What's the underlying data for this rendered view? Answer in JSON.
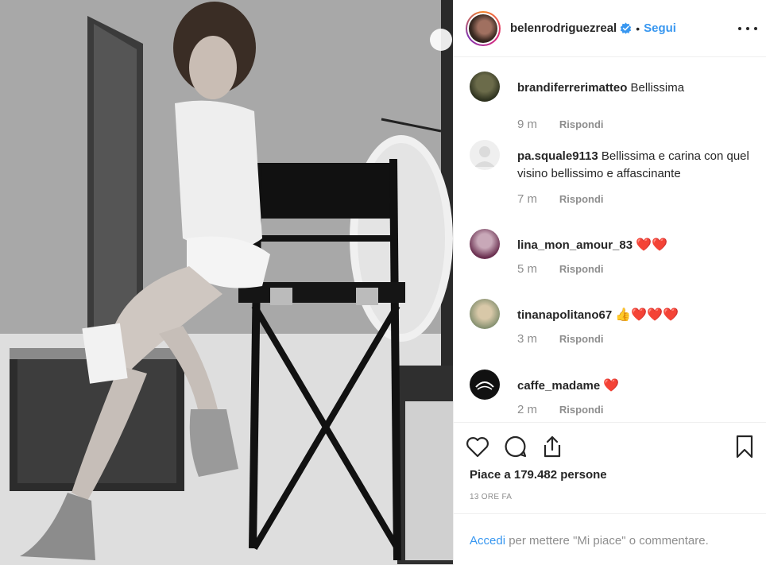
{
  "header": {
    "username": "belenrodriguezreal",
    "separator": "•",
    "follow_label": "Segui",
    "verified_icon": "verified-badge-icon",
    "more_icon": "more-options-icon"
  },
  "comments": [
    {
      "username": "brandiferrerimatteo",
      "text": "Bellissima",
      "emoji": "",
      "ago": "9 m",
      "reply": "Rispondi"
    },
    {
      "username": "pa.squale9113",
      "text": "Bellissima e carina con quel visino bellissimo e affascinante",
      "emoji": "",
      "ago": "7 m",
      "reply": "Rispondi"
    },
    {
      "username": "lina_mon_amour_83",
      "text": "",
      "emoji": "❤️❤️",
      "ago": "5 m",
      "reply": "Rispondi"
    },
    {
      "username": "tinanapolitano67",
      "text": "",
      "emoji": "👍❤️❤️❤️",
      "ago": "3 m",
      "reply": "Rispondi"
    },
    {
      "username": "caffe_madame",
      "text": "",
      "emoji": "❤️",
      "ago": "2 m",
      "reply": "Rispondi"
    }
  ],
  "actions": {
    "like_icon": "heart-outline-icon",
    "comment_icon": "comment-bubble-icon",
    "share_icon": "share-icon",
    "save_icon": "bookmark-icon"
  },
  "likes_text": "Piace a 179.482 persone",
  "timestamp": "13 ore fa",
  "footer": {
    "login_link": "Accedi",
    "rest": " per mettere \"Mi piace\" o commentare."
  },
  "colors": {
    "link_blue": "#3897f0",
    "text": "#262626",
    "muted": "#8e8e8e",
    "heart_red": "#e0192f"
  }
}
